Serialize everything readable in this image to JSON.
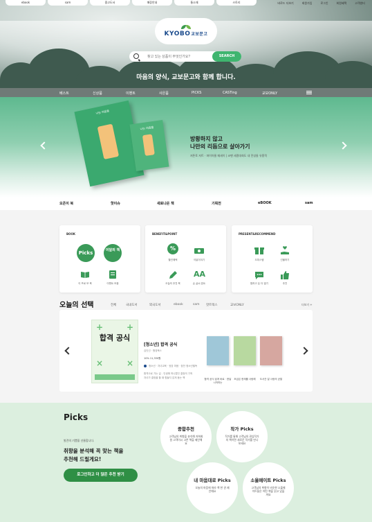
{
  "top_tabs": [
    "ebook",
    "sam",
    "중고도서",
    "매장안내",
    "통소재",
    "스토리"
  ],
  "top_links": [
    "바로드 더보기",
    "회원가입",
    "로그인",
    "회원혜택",
    "고객센터"
  ],
  "logo": {
    "name": "KYOBO",
    "sub": "교보문고"
  },
  "search": {
    "placeholder": "찾고 있는 상품이 무엇인가요?",
    "button": "SEARCH"
  },
  "tagline": "마음의 양식, 교보문고와 함께 합니다.",
  "gnb": [
    "베스트",
    "신상품",
    "이벤트",
    "사은품",
    "PICKS",
    "CASTing",
    "교보ONLY"
  ],
  "banner": {
    "headline1": "방황하지 않고",
    "headline2": "나만의 리듬으로 살아가기",
    "sub": "저튼토 저트 · 파이아울 메세이 | 코펜 세종대회도 내 전성들 유흥적",
    "book1_text": "나는 마음을",
    "book2_text": "나는 마음을"
  },
  "subnav": [
    "오픈이 북",
    "핫이슈",
    "새로나온 책",
    "기획전",
    "eBOOK",
    "sam"
  ],
  "cards": [
    {
      "title": "BOOK",
      "items": [
        "Picks",
        "이달의 책",
        "이 프로 모 북",
        "이벤트 모음"
      ]
    },
    {
      "title": "BENEFIT&POINT",
      "items": [
        "할인혜택",
        "이달이야기",
        "오늘의 추천 북",
        "손 글씨 폰트"
      ]
    },
    {
      "title": "PRESENT&RECOMMEND",
      "items": [
        "오피스템",
        "선물하기",
        "찜하고 돈 더 벌기",
        "추천"
      ]
    }
  ],
  "choice": {
    "title": "오늘의 선택",
    "tabs": [
      "전체",
      "국내도서",
      "외국도서",
      "ebook",
      "sam",
      "핫트렉스",
      "교보ONLY"
    ],
    "more": "더보기 +",
    "book_cover_text": "합격 공식",
    "book_title": "[청소년] 합격 공식",
    "author": "김인선 · 원영북스",
    "price": "10% 11,330원",
    "tag": "청소년 · 자녀교육 · 뒷장 마음 · 잠잔 청소년필독",
    "desc1": "합격으로 가는 길 - 인생에 하나뿐인 결정의 기적",
    "desc2": "자녀가 결정을 할 때 힘들지 않게 돕는 책",
    "thumbs": [
      {
        "label": "합격 공식 쉽게 바로 · 한달 시작하는",
        "color": "#9fc7d8"
      },
      {
        "label": "조금은 현재를 사랑해",
        "color": "#b8d9a0"
      },
      {
        "label": "도서관 잘 사랑의 균열",
        "color": "#d6a7a0"
      }
    ]
  },
  "picks": {
    "heading": "Picks",
    "small": "발견의 기쁨을 선물합니다.",
    "lead1": "취향을 분석해 꼭 맞는 책을",
    "lead2": "추천해 드릴게요!",
    "cta": "로그인하고 더 많은 추천 받기",
    "circles": [
      {
        "title": "종합추천",
        "desc": "고객님의 취향을 분석해 저희회원 고객이시 고른 책을 제안해요"
      },
      {
        "title": "작가 Picks",
        "desc": "작가를 통해 고객님의 관심작가의 책이면 새로운 작가를 만나보세요"
      },
      {
        "title": "내 마음대로 Picks",
        "desc": "오늘의 마음에 따라 책 한 권 제안해요"
      },
      {
        "title": "소울메이트 Picks",
        "desc": "고객님의 취향이 비슷한 소울메이트들은 어떤 책을 읽고 있을까요"
      }
    ]
  }
}
